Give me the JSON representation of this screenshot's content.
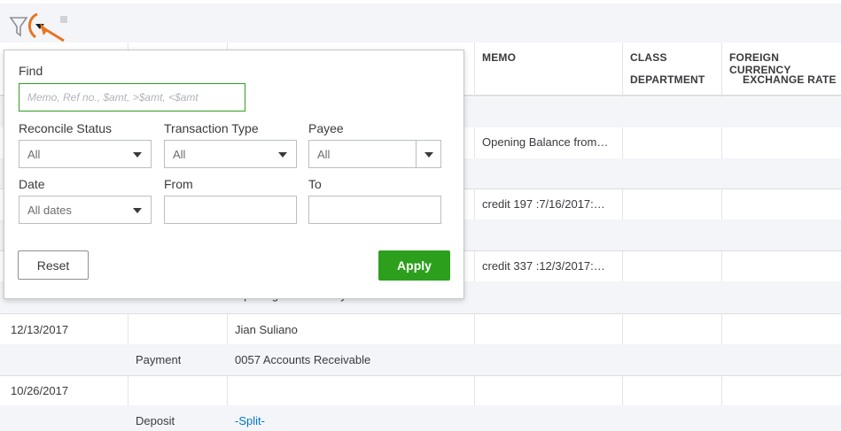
{
  "toolbar": {
    "filter_icon": "funnel-icon",
    "dropdown_icon": "caret-down-icon"
  },
  "table": {
    "columns": {
      "memo": "MEMO",
      "class": "CLASS",
      "department": "DEPARTMENT",
      "fx_line1": "FOREIGN CURRENCY",
      "fx_line2": "EXCHANGE RATE"
    },
    "rows": {
      "r1_memo": "Opening Balance from…",
      "r2_memo": "credit 197 :7/16/2017:…",
      "r3_memo": "credit 337 :12/3/2017:…",
      "r4_partial": "Opening Balance Pay",
      "r5_date": "12/13/2017",
      "r5_name": "Jian Suliano",
      "r6_type": "Payment",
      "r6_account": "0057 Accounts Receivable",
      "r7_date": "10/26/2017",
      "r8_type": "Deposit",
      "r8_account": "-Split-"
    }
  },
  "filter": {
    "find_label": "Find",
    "find_placeholder": "Memo, Ref no., $amt, >$amt, <$amt",
    "reconcile_label": "Reconcile Status",
    "reconcile_value": "All",
    "type_label": "Transaction Type",
    "type_value": "All",
    "payee_label": "Payee",
    "payee_value": "All",
    "date_label": "Date",
    "date_value": "All dates",
    "from_label": "From",
    "to_label": "To",
    "reset_label": "Reset",
    "apply_label": "Apply"
  },
  "colors": {
    "apply_green": "#2ca01c",
    "find_border": "#2ca01c",
    "link_blue": "#0077c5",
    "cursor_orange": "#e8741e"
  }
}
